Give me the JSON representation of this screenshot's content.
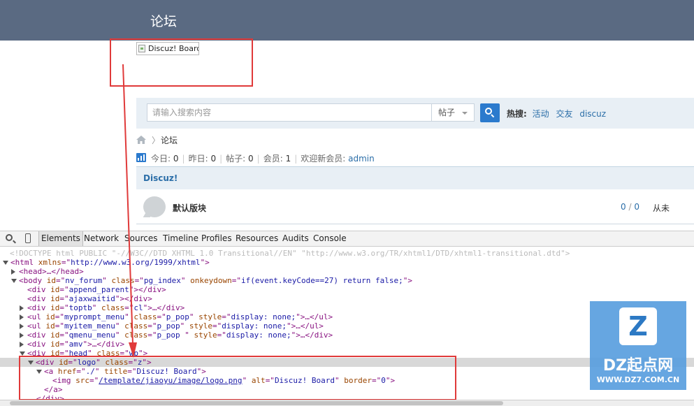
{
  "header": {
    "title": "论坛"
  },
  "logo": {
    "alt": "Discuz! Board"
  },
  "search": {
    "placeholder": "请输入搜索内容",
    "type": "帖子",
    "hot_label": "热搜:",
    "hot_links": [
      "活动",
      "交友",
      "discuz"
    ]
  },
  "breadcrumb": {
    "label": "论坛"
  },
  "stats": {
    "today_label": "今日:",
    "today": "0",
    "yesterday_label": "昨日:",
    "yesterday": "0",
    "posts_label": "帖子:",
    "posts": "0",
    "members_label": "会员:",
    "members": "1",
    "newest_label": "欢迎新会员:",
    "newest": "admin"
  },
  "forum": {
    "category": "Discuz!",
    "name": "默认版块",
    "topics": "0",
    "posts": "0",
    "last": "从未"
  },
  "devtools": {
    "tabs": [
      "Elements",
      "Network",
      "Sources",
      "Timeline",
      "Profiles",
      "Resources",
      "Audits",
      "Console"
    ],
    "active_tab": "Elements",
    "lines": {
      "doctype": "<!DOCTYPE html PUBLIC \"-//W3C//DTD XHTML 1.0 Transitional//EN\" \"http://www.w3.org/TR/xhtml1/DTD/xhtml1-transitional.dtd\">",
      "html_tag": "html",
      "html_attr": "xmlns",
      "html_val": "http://www.w3.org/1999/xhtml",
      "head_tag": "<head>…</head>",
      "body_tag": "body",
      "body_id": "nv_forum",
      "body_class": "pg_index",
      "body_onkey": "if(event.keyCode==27) return false;",
      "div_append": "append_parent",
      "div_ajax": "ajaxwaitid",
      "div_toptb": "toptb",
      "div_toptb_class": "cl",
      "ul1_id": "myprompt_menu",
      "ul1_class": "p_pop",
      "ul1_style": "display: none;",
      "ul2_id": "myitem_menu",
      "ul2_class": "p_pop",
      "ul2_style": "display: none;",
      "ul3_id": "qmenu_menu",
      "ul3_class": "p_pop ",
      "ul3_style": "display: none;",
      "div_amv": "amv",
      "div_head": "head",
      "div_head_class": "wp",
      "div_logo": "logo",
      "div_logo_class": "z",
      "a_href": "./",
      "a_title": "Discuz! Board",
      "img_src": "/template/jiaoyu/image/logo.png",
      "img_alt": "Discuz! Board",
      "img_border": "0",
      "close_a": "</a>",
      "close_div": "</div>"
    }
  },
  "watermark": {
    "badge": "Z",
    "name": "DZ起点网",
    "url": "WWW.DZ7.COM.CN"
  },
  "colors": {
    "header_bg": "#5a6a82",
    "highlight_red": "#e03a3a",
    "link_blue": "#2b6ea8",
    "accent_blue": "#2b7acd"
  }
}
